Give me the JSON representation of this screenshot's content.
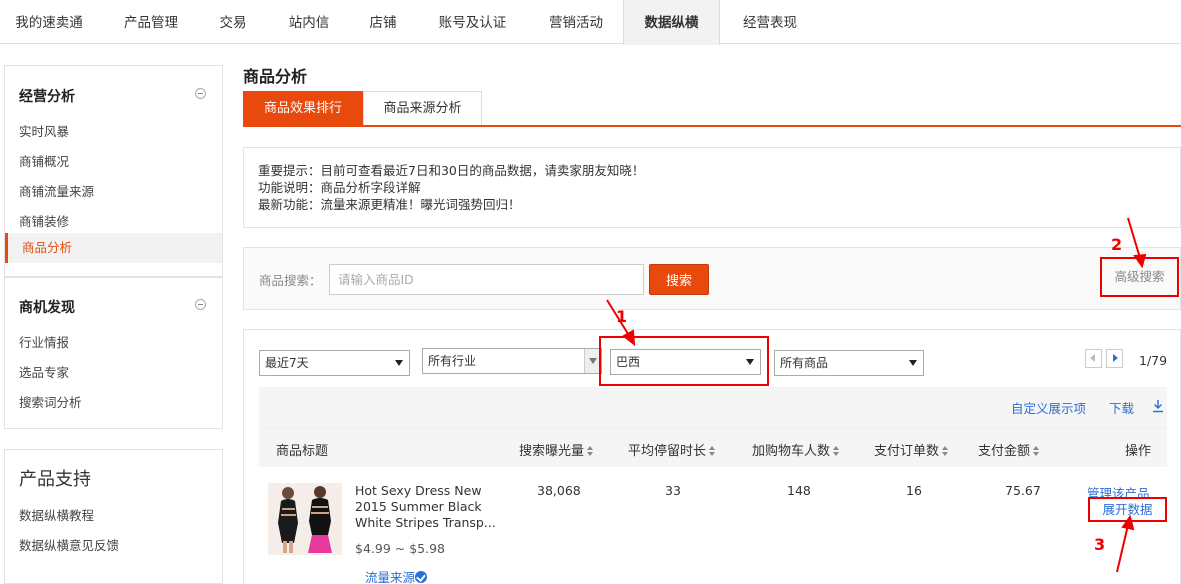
{
  "topnav": {
    "tabs": [
      "我的速卖通",
      "产品管理",
      "交易",
      "站内信",
      "店铺",
      "账号及认证",
      "营销活动",
      "数据纵横",
      "经营表现"
    ],
    "active_index": 7
  },
  "sidebar": {
    "sec1": {
      "title": "经营分析",
      "items": [
        "实时风暴",
        "商铺概况",
        "商铺流量来源",
        "商铺装修",
        "商品分析"
      ],
      "active_index": 4
    },
    "sec2": {
      "title": "商机发现",
      "items": [
        "行业情报",
        "选品专家",
        "搜索词分析"
      ]
    },
    "sec3": {
      "title": "产品支持",
      "items": [
        "数据纵横教程",
        "数据纵横意见反馈"
      ]
    }
  },
  "main": {
    "title": "商品分析",
    "subtabs": [
      "商品效果排行",
      "商品来源分析"
    ],
    "notice": [
      "重要提示：目前可查看最近7日和30日的商品数据，请卖家朋友知晓！",
      "功能说明：商品分析字段详解",
      "最新功能：流量来源更精准！曝光词强势回归！"
    ],
    "search": {
      "label": "商品搜索：",
      "placeholder": "请输入商品ID",
      "button": "搜索",
      "advanced": "高级搜索"
    },
    "filters": {
      "period": "最近7天",
      "industry": "所有行业",
      "country": "巴西",
      "products": "所有商品"
    },
    "pager": "1/79",
    "toolbar": {
      "customize": "自定义展示项",
      "download": "下载"
    },
    "columns": [
      "商品标题",
      "搜索曝光量",
      "平均停留时长",
      "加购物车人数",
      "支付订单数",
      "支付金额",
      "操作"
    ],
    "row": {
      "title": "Hot Sexy Dress New 2015 Summer Black White Stripes Transp...",
      "price": "$4.99 ~ $5.98",
      "traffic_source": "流量来源",
      "impressions": "38,068",
      "avg_stay": "33",
      "add_to_cart": "148",
      "orders": "16",
      "amount": "75.67",
      "manage": "管理该产品",
      "expand": "展开数据"
    }
  },
  "annotations": [
    "1",
    "2",
    "3"
  ],
  "colors": {
    "accent": "#e8490c",
    "link": "#2a6fd6",
    "annotation": "#e00000"
  }
}
